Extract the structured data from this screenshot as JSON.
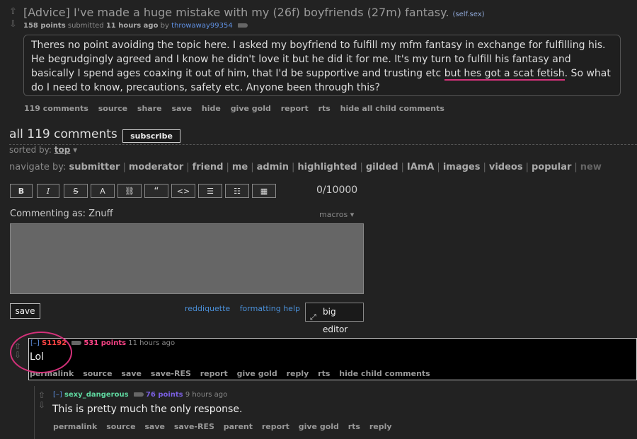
{
  "post": {
    "title": "[Advice] I've made a huge mistake with my (26f) boyfriends (27m) fantasy.",
    "domain": "(self.sex)",
    "points": "158 points",
    "submitted": "submitted",
    "time": "11 hours ago",
    "by": "by",
    "author": "throwaway99354",
    "selftext_before": "Theres no point avoiding the topic here. I asked my boyfriend to fulfill my mfm fantasy in exchange for fulfilling his. He begrudgingly agreed and I know he didn't love it but he did it for me. It's my turn to fulfill his fantasy and basically I spend ages coaxing it out of him, that I'd be supportive and trusting etc ",
    "selftext_highlight": "but hes got a scat fetish",
    "selftext_after": ". So what do I need to know, precautions, safety etc. Anyone been through this?",
    "buttons": [
      "119 comments",
      "source",
      "share",
      "save",
      "hide",
      "give gold",
      "report",
      "rts",
      "hide all child comments"
    ]
  },
  "comments_area": {
    "title": "all 119 comments",
    "subscribe": "subscribe",
    "sorted_by_label": "sorted by:",
    "sorted_by_value": "top",
    "navigate_label": "navigate by:",
    "navigate_items": [
      "submitter",
      "moderator",
      "friend",
      "me",
      "admin",
      "highlighted",
      "gilded",
      "IAmA",
      "images",
      "videos",
      "popular"
    ],
    "navigate_dim": "new"
  },
  "editor": {
    "toolbar": [
      "B",
      "I",
      "S",
      "A",
      "⛓",
      "“",
      "<>",
      "☰",
      "☷",
      "▦"
    ],
    "counter": "0/10000",
    "commenting_as": "Commenting as: Znuff",
    "macros": "macros",
    "save": "save",
    "help_links": [
      "reddiquette",
      "formatting help"
    ],
    "big_editor": "big editor"
  },
  "comment1": {
    "collapse": "[–]",
    "author": "S1192",
    "points": "531 points",
    "time": "11 hours ago",
    "body": "Lol",
    "buttons": [
      "permalink",
      "source",
      "save",
      "save-RES",
      "report",
      "give gold",
      "reply",
      "rts",
      "hide child comments"
    ],
    "author_color": "#ff4444",
    "points_color": "#ff4488"
  },
  "comment2": {
    "collapse": "[–]",
    "author": "sexy_dangerous",
    "points": "76 points",
    "time": "9 hours ago",
    "body": "This is pretty much the only response.",
    "buttons": [
      "permalink",
      "source",
      "save",
      "save-RES",
      "parent",
      "report",
      "give gold",
      "rts",
      "reply"
    ],
    "author_color": "#5fd8a0",
    "points_color": "#7a5fe0"
  },
  "colors": {
    "highlight_underline": "#d4317a",
    "link_blue": "#4a8fd8"
  }
}
